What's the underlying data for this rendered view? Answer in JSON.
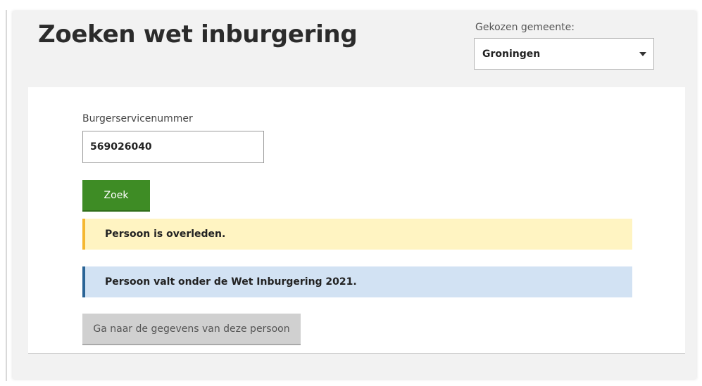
{
  "page": {
    "title": "Zoeken wet inburgering"
  },
  "municipality": {
    "label": "Gekozen gemeente:",
    "selected": "Groningen"
  },
  "search": {
    "bsn_label": "Burgerservicenummer",
    "bsn_value": "569026040",
    "button_label": "Zoek"
  },
  "alerts": {
    "warning": "Persoon is overleden.",
    "info": "Persoon valt onder de Wet Inburgering 2021."
  },
  "actions": {
    "details_label": "Ga naar de gegevens van deze persoon"
  },
  "colors": {
    "primary_button": "#3e8c25",
    "warning_background": "#fff4c2",
    "warning_accent": "#f5b731",
    "info_background": "#d2e2f3",
    "info_accent": "#2a6496",
    "disabled_button": "#d0d0d0"
  },
  "icons": {
    "select_caret": "caret-down-icon"
  }
}
